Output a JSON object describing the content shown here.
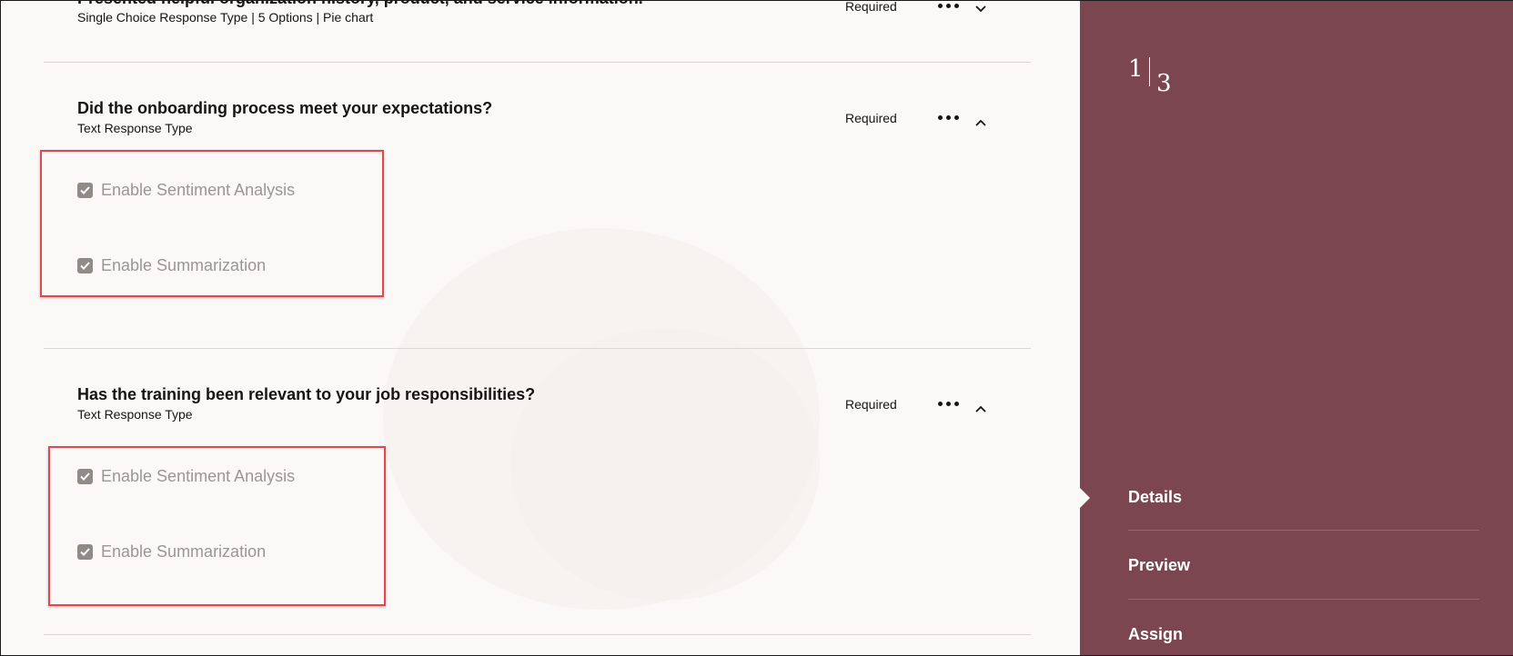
{
  "questions": [
    {
      "title": "Presented helpful organization history, product, and service information.",
      "subtitle": "Single Choice Response Type | 5 Options | Pie chart",
      "required_label": "Required",
      "expanded": false
    },
    {
      "title": "Did the onboarding process meet your expectations?",
      "subtitle": "Text Response Type",
      "required_label": "Required",
      "expanded": true,
      "options": [
        {
          "label": "Enable Sentiment Analysis",
          "checked": true
        },
        {
          "label": "Enable Summarization",
          "checked": true
        }
      ]
    },
    {
      "title": "Has the training been relevant to your job responsibilities?",
      "subtitle": "Text Response Type",
      "required_label": "Required",
      "expanded": true,
      "options": [
        {
          "label": "Enable Sentiment Analysis",
          "checked": true
        },
        {
          "label": "Enable Summarization",
          "checked": true
        }
      ]
    }
  ],
  "sidebar": {
    "step_current": "1",
    "step_total": "3",
    "nav": [
      {
        "label": "Details",
        "active": true
      },
      {
        "label": "Preview",
        "active": false
      },
      {
        "label": "Assign",
        "active": false
      }
    ]
  },
  "colors": {
    "sidebar_bg": "#7b4650",
    "page_bg": "#fbf9f8",
    "highlight": "#e5464b",
    "checkbox": "#8f8c88"
  },
  "icons": {
    "more": "more-options-icon",
    "collapse": "chevron-up-icon",
    "expand": "chevron-down-icon",
    "check": "checkmark-icon"
  }
}
